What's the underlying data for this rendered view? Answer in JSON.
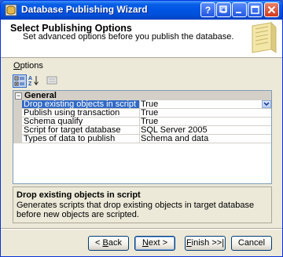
{
  "window": {
    "title": "Database Publishing Wizard",
    "controls": [
      "help-icon",
      "restore-icon",
      "minimize-icon",
      "maximize-icon",
      "close-icon"
    ]
  },
  "header": {
    "title": "Select Publishing Options",
    "subtitle": "Set advanced options before you publish the database."
  },
  "options_label_accel": "O",
  "options_label_rest": "ptions",
  "toolbar": {
    "buttons": [
      "categorized-icon",
      "alphabetical-icon",
      "property-pages-icon"
    ]
  },
  "grid": {
    "category": "General",
    "category_toggle": "−",
    "rows": [
      {
        "name": "Drop existing objects in script",
        "value": "True"
      },
      {
        "name": "Publish using transaction",
        "value": "True"
      },
      {
        "name": "Schema qualify",
        "value": "True"
      },
      {
        "name": "Script for target database",
        "value": "SQL Server 2005"
      },
      {
        "name": "Types of data to publish",
        "value": "Schema and data"
      }
    ]
  },
  "help": {
    "title": "Drop existing objects in script",
    "text": "Generates scripts that drop existing objects in target database before new objects are scripted."
  },
  "buttons": {
    "back_prefix": "< ",
    "back_accel": "B",
    "back_rest": "ack",
    "next_accel": "N",
    "next_rest": "ext >",
    "finish_accel": "F",
    "finish_rest": "inish >>|",
    "cancel": "Cancel"
  },
  "colors": {
    "titlebar": "#0055e5",
    "selection": "#316ac5",
    "window_bg": "#ece9d8"
  }
}
